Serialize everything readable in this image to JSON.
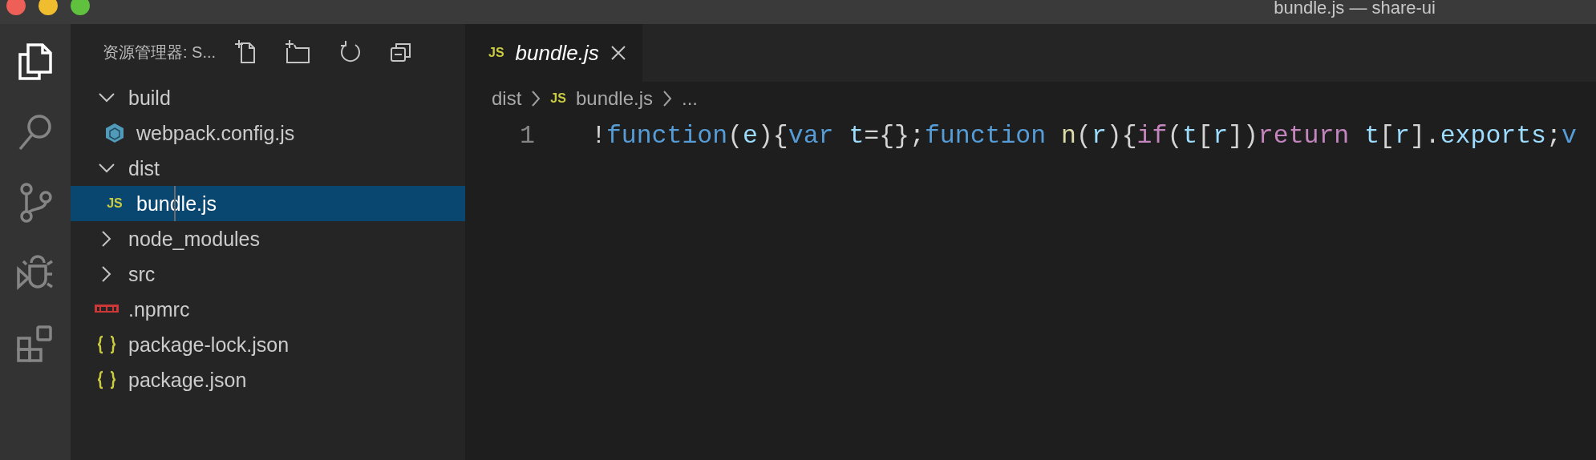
{
  "window": {
    "title": "bundle.js — share-ui"
  },
  "activity_bar": [
    {
      "kind": "explorer",
      "selected": true
    },
    {
      "kind": "search",
      "selected": false
    },
    {
      "kind": "scm",
      "selected": false
    },
    {
      "kind": "debug",
      "selected": false
    },
    {
      "kind": "extensions",
      "selected": false
    }
  ],
  "sidebar": {
    "title": "资源管理器: S...",
    "tree": [
      {
        "label": "build",
        "kind": "folder",
        "expanded": true,
        "selected": false,
        "children": [
          {
            "label": "webpack.config.js",
            "kind": "webpack",
            "selected": false
          }
        ]
      },
      {
        "label": "dist",
        "kind": "folder",
        "expanded": true,
        "selected": false,
        "children": [
          {
            "label": "bundle.js",
            "kind": "js",
            "icon": "JS",
            "selected": true
          }
        ]
      },
      {
        "label": "node_modules",
        "kind": "folder",
        "expanded": false,
        "selected": false
      },
      {
        "label": "src",
        "kind": "folder",
        "expanded": false,
        "selected": false
      },
      {
        "label": ".npmrc",
        "kind": "npm",
        "selected": false
      },
      {
        "label": "package-lock.json",
        "kind": "json",
        "selected": false
      },
      {
        "label": "package.json",
        "kind": "json",
        "selected": false
      }
    ]
  },
  "tabs": [
    {
      "label": "bundle.js",
      "icon": "JS",
      "selected": true
    }
  ],
  "breadcrumb": [
    {
      "label": "dist"
    },
    {
      "label": "bundle.js",
      "icon": "JS"
    },
    {
      "label": "..."
    }
  ],
  "editor": {
    "lines": [
      {
        "number": "1",
        "tokens": [
          {
            "text": "!",
            "kind": "punct"
          },
          {
            "text": "function",
            "kind": "keyword"
          },
          {
            "text": "(",
            "kind": "punct"
          },
          {
            "text": "e",
            "kind": "var"
          },
          {
            "text": "){",
            "kind": "punct"
          },
          {
            "text": "var ",
            "kind": "keyword"
          },
          {
            "text": "t",
            "kind": "var"
          },
          {
            "text": "={};",
            "kind": "punct"
          },
          {
            "text": "function ",
            "kind": "keyword"
          },
          {
            "text": "n",
            "kind": "func"
          },
          {
            "text": "(",
            "kind": "punct"
          },
          {
            "text": "r",
            "kind": "var"
          },
          {
            "text": "){",
            "kind": "punct"
          },
          {
            "text": "if",
            "kind": "control"
          },
          {
            "text": "(",
            "kind": "punct"
          },
          {
            "text": "t",
            "kind": "var"
          },
          {
            "text": "[",
            "kind": "punct"
          },
          {
            "text": "r",
            "kind": "var"
          },
          {
            "text": "])",
            "kind": "punct"
          },
          {
            "text": "return ",
            "kind": "control"
          },
          {
            "text": "t",
            "kind": "var"
          },
          {
            "text": "[",
            "kind": "punct"
          },
          {
            "text": "r",
            "kind": "var"
          },
          {
            "text": "].",
            "kind": "punct"
          },
          {
            "text": "exports",
            "kind": "var"
          },
          {
            "text": ";",
            "kind": "punct"
          },
          {
            "text": "v",
            "kind": "keyword"
          }
        ]
      }
    ]
  }
}
